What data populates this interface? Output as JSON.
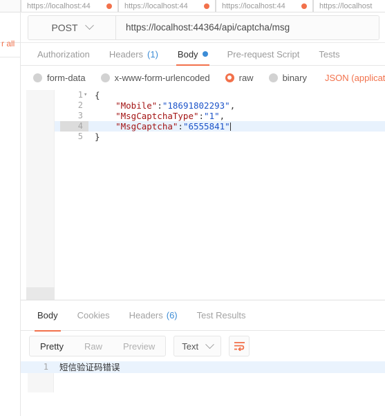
{
  "left_strip": {
    "clear_all_label": "r all"
  },
  "request_tabs": [
    {
      "label": "https://localhost:44",
      "dot": true
    },
    {
      "label": "https://localhost:44",
      "dot": true
    },
    {
      "label": "https://localhost:44",
      "dot": true
    },
    {
      "label": "https://localhost",
      "dot": false
    }
  ],
  "url_bar": {
    "method": "POST",
    "url": "https://localhost:44364/api/captcha/msg"
  },
  "request_section_tabs": [
    {
      "label": "Authorization",
      "count": "",
      "active": false,
      "dot": false
    },
    {
      "label": "Headers",
      "count": "(1)",
      "active": false,
      "dot": false
    },
    {
      "label": "Body",
      "count": "",
      "active": true,
      "dot": true
    },
    {
      "label": "Pre-request Script",
      "count": "",
      "active": false,
      "dot": false
    },
    {
      "label": "Tests",
      "count": "",
      "active": false,
      "dot": false
    }
  ],
  "body_types": {
    "options": [
      {
        "label": "form-data",
        "checked": false
      },
      {
        "label": "x-www-form-urlencoded",
        "checked": false
      },
      {
        "label": "raw",
        "checked": true
      },
      {
        "label": "binary",
        "checked": false
      }
    ],
    "content_type": "JSON (application/js"
  },
  "editor": {
    "lines": [
      {
        "no": "1",
        "fold": "▾",
        "parts": [
          {
            "t": "{",
            "c": "tok-punc"
          }
        ],
        "highlight": false
      },
      {
        "no": "2",
        "fold": "",
        "parts": [
          {
            "t": "    \"Mobile\"",
            "c": "tok-key"
          },
          {
            "t": ":",
            "c": "tok-punc"
          },
          {
            "t": "\"18691802293\"",
            "c": "tok-val"
          },
          {
            "t": ",",
            "c": "tok-punc"
          }
        ],
        "highlight": false
      },
      {
        "no": "3",
        "fold": "",
        "parts": [
          {
            "t": "    \"MsgCaptchaType\"",
            "c": "tok-key"
          },
          {
            "t": ":",
            "c": "tok-punc"
          },
          {
            "t": "\"1\"",
            "c": "tok-val"
          },
          {
            "t": ",",
            "c": "tok-punc"
          }
        ],
        "highlight": false
      },
      {
        "no": "4",
        "fold": "",
        "parts": [
          {
            "t": "    \"MsgCaptcha\"",
            "c": "tok-key"
          },
          {
            "t": ":",
            "c": "tok-punc"
          },
          {
            "t": "\"6555841\"",
            "c": "tok-val"
          }
        ],
        "highlight": true,
        "caret": true
      },
      {
        "no": "5",
        "fold": "",
        "parts": [
          {
            "t": "}",
            "c": "tok-punc"
          }
        ],
        "highlight": false
      }
    ]
  },
  "response_tabs": [
    {
      "label": "Body",
      "count": "",
      "active": true
    },
    {
      "label": "Cookies",
      "count": "",
      "active": false
    },
    {
      "label": "Headers",
      "count": "(6)",
      "active": false
    },
    {
      "label": "Test Results",
      "count": "",
      "active": false
    }
  ],
  "response_toolbar": {
    "view_modes": [
      {
        "label": "Pretty",
        "active": true
      },
      {
        "label": "Raw",
        "active": false
      },
      {
        "label": "Preview",
        "active": false
      }
    ],
    "format": "Text",
    "wrap_icon": "word-wrap-icon"
  },
  "response_body": {
    "lines": [
      {
        "no": "1",
        "text": "短信验证码错误"
      }
    ]
  },
  "colors": {
    "accent": "#f2714b",
    "info": "#3c8cd6",
    "highlight": "#e8f2fd",
    "json_key": "#a31515",
    "json_value": "#1d54c9"
  }
}
